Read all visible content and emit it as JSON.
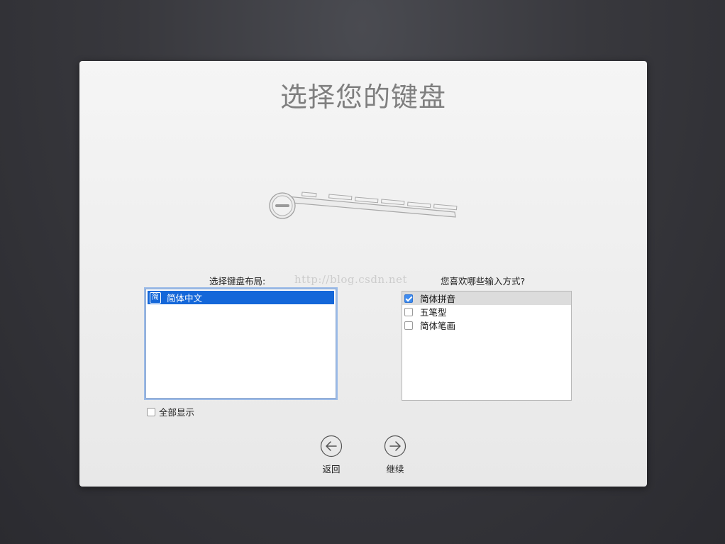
{
  "page": {
    "title": "选择您的键盘"
  },
  "layout_section": {
    "label": "选择键盘布局:",
    "items": [
      {
        "badge": "简",
        "label": "简体中文",
        "selected": true
      }
    ],
    "show_all_label": "全部显示",
    "show_all_checked": false
  },
  "watermark": "http://blog.csdn.net",
  "input_section": {
    "label": "您喜欢哪些输入方式?",
    "items": [
      {
        "label": "简体拼音",
        "checked": true
      },
      {
        "label": "五笔型",
        "checked": false
      },
      {
        "label": "简体笔画",
        "checked": false
      }
    ]
  },
  "nav": {
    "back_label": "返回",
    "back_icon": "arrow-left-circle-icon",
    "continue_label": "继续",
    "continue_icon": "arrow-right-circle-icon"
  },
  "illustration": "keyboard-icon",
  "colors": {
    "selection": "#1467d9",
    "checkbox_checked": "#3d8bf0",
    "title_text": "#7f7f7f"
  }
}
